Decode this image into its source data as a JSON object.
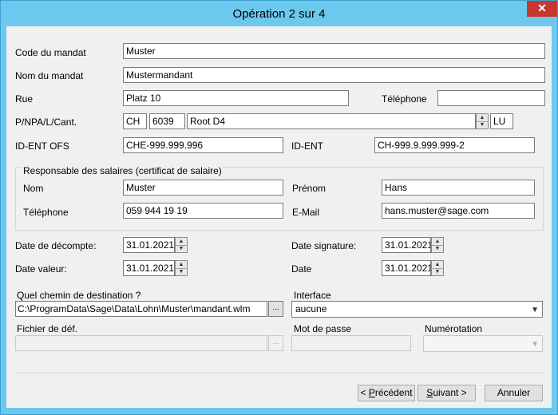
{
  "window": {
    "title": "Opération 2 sur 4",
    "close": "✕"
  },
  "mandate": {
    "code_label": "Code du mandat",
    "code_value": "Muster",
    "name_label": "Nom du mandat",
    "name_value": "Mustermandant",
    "street_label": "Rue",
    "street_value": "Platz 10",
    "phone_label": "Téléphone",
    "phone_value": "",
    "location_label": "P/NPA/L/Cant.",
    "country_value": "CH",
    "zip_value": "6039",
    "city_value": "Root D4",
    "canton_value": "LU",
    "ofs_label": "ID-ENT OFS",
    "ofs_value": "CHE-999.999.996",
    "ident_label": "ID-ENT",
    "ident_value": "CH-999.9.999.999-2"
  },
  "payroll_contact": {
    "group_title": "Responsable des salaires (certificat de salaire)",
    "lastname_label": "Nom",
    "lastname_value": "Muster",
    "firstname_label": "Prénom",
    "firstname_value": "Hans",
    "phone_label": "Téléphone",
    "phone_value": "059 944 19 19",
    "email_label": "E-Mail",
    "email_value": "hans.muster@sage.com"
  },
  "dates": {
    "decompte_label": "Date de décompte:",
    "decompte_value": "31.01.2021",
    "signature_label": "Date signature:",
    "signature_value": "31.01.2021",
    "valeur_label": "Date valeur:",
    "valeur_value": "31.01.2021",
    "date_label": "Date",
    "date_value": "31.01.2021"
  },
  "destination": {
    "path_label": "Quel chemin de destination ?",
    "path_value": "C:\\ProgramData\\Sage\\Data\\Lohn\\Muster\\mandant.wlm",
    "interface_label": "Interface",
    "interface_value": "aucune",
    "def_file_label": "Fichier de déf.",
    "def_file_value": "",
    "password_label": "Mot de passe",
    "password_value": "",
    "numbering_label": "Numérotation",
    "numbering_value": "",
    "browse_label": "..."
  },
  "buttons": {
    "prev_prefix": "< ",
    "prev_u": "P",
    "prev_rest": "récédent",
    "next_u": "S",
    "next_rest": "uivant >",
    "cancel": "Annuler"
  }
}
